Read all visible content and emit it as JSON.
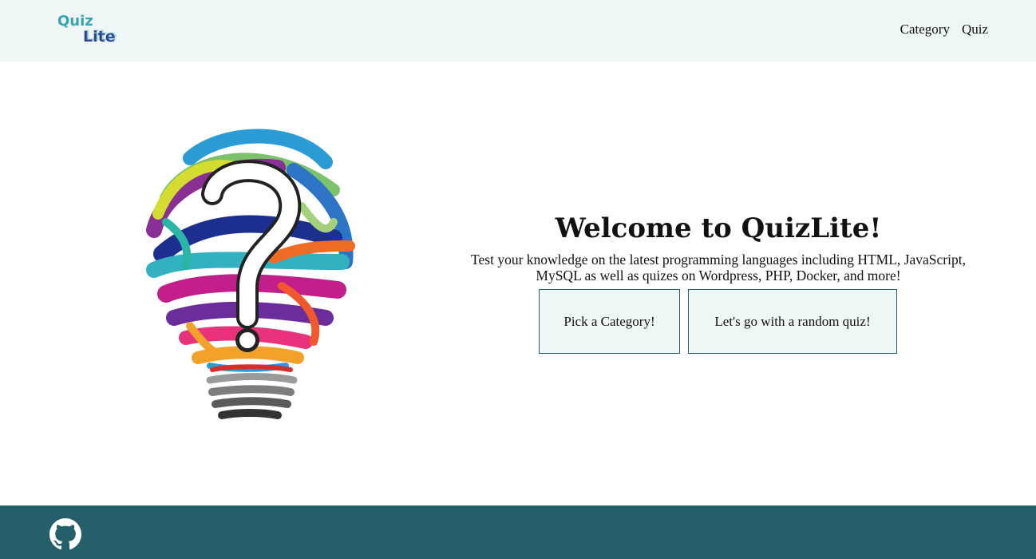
{
  "brand": {
    "logo_line1": "Quiz",
    "logo_line2": "Lite",
    "colors": {
      "teal": "#39a3b1",
      "navy": "#2d3a8c",
      "nav_bg": "#eef7f6",
      "footer_bg": "#245f6a",
      "button_border": "#2a5f68"
    }
  },
  "nav": {
    "links": [
      {
        "label": "Category"
      },
      {
        "label": "Quiz"
      }
    ]
  },
  "hero": {
    "image_icon": "lightbulb-question-mark-illustration",
    "title": "Welcome to QuizLite!",
    "subtitle": "Test your knowledge on the latest programming languages including HTML, JavaScript, MySQL as well as quizes on Wordpress, PHP, Docker, and more!",
    "buttons": {
      "category": "Pick a Category!",
      "random": "Let's go with a random quiz!"
    }
  },
  "footer": {
    "icon": "github-icon"
  }
}
